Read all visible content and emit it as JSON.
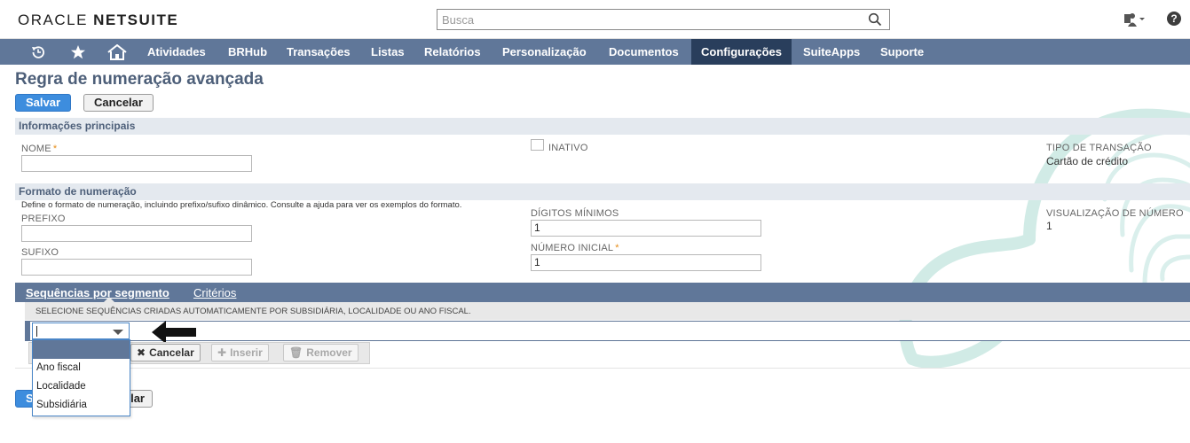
{
  "header": {
    "logo_oracle": "ORACLE",
    "logo_netsuite": "NETSUITE",
    "search_placeholder": "Busca"
  },
  "nav": {
    "items": [
      "Atividades",
      "BRHub",
      "Transações",
      "Listas",
      "Relatórios",
      "Personalização",
      "Documentos",
      "Configurações",
      "SuiteApps",
      "Suporte"
    ],
    "active": "Configurações"
  },
  "page": {
    "title": "Regra de numeração avançada",
    "save_label": "Salvar",
    "cancel_label": "Cancelar"
  },
  "main_info": {
    "section_title": "Informações principais",
    "name_label": "NOME",
    "name_value": "",
    "inactive_label": "INATIVO",
    "transaction_type_label": "TIPO DE TRANSAÇÃO",
    "transaction_type_value": "Cartão de crédito"
  },
  "format": {
    "section_title": "Formato de numeração",
    "help_text": "Define o formato de numeração, incluindo prefixo/sufixo dinâmico. Consulte a ajuda para ver os exemplos do formato.",
    "prefix_label": "PREFIXO",
    "prefix_value": "",
    "suffix_label": "SUFIXO",
    "suffix_value": "",
    "min_digits_label": "DÍGITOS MÍNIMOS",
    "min_digits_value": "1",
    "start_number_label": "NÚMERO INICIAL",
    "start_number_value": "1",
    "preview_label": "VISUALIZAÇÃO DE NÚMERO",
    "preview_value": "1"
  },
  "subtabs": {
    "tab1": "Sequências por segmento",
    "tab2": "Critérios",
    "instruction": "SELECIONE SEQUÊNCIAS CRIADAS AUTOMATICAMENTE POR SUBSIDIÁRIA, LOCALIDADE OU ANO FISCAL.",
    "line_cancel": "Cancelar",
    "line_insert": "Inserir",
    "line_remove": "Remover",
    "dropdown_options": [
      "",
      "Ano fiscal",
      "Localidade",
      "Subsidiária"
    ]
  },
  "bottom": {
    "save_fragment": "S",
    "cancel_fragment": "lar"
  },
  "colors": {
    "nav_bg": "#607799",
    "nav_active": "#293e5c",
    "primary_button": "#3d8dde",
    "section_bg": "#e4e9ef",
    "title_color": "#4d5f79"
  },
  "icons": {
    "recent": "history-icon",
    "favorites": "star-icon",
    "home": "home-icon",
    "search": "search-icon",
    "user": "user-roles-icon",
    "help": "help-icon"
  }
}
